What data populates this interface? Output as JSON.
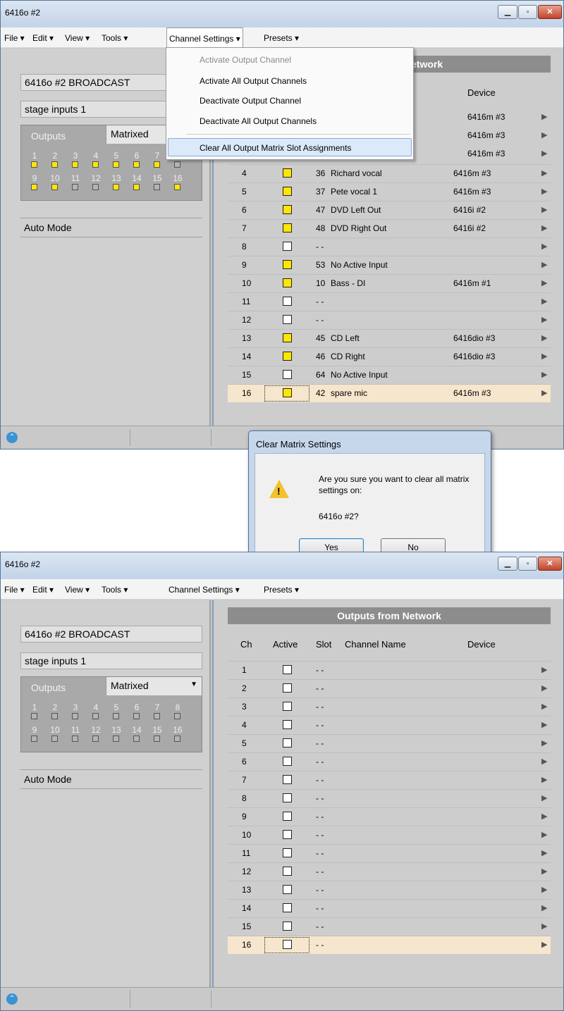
{
  "window_title": "6416o #2",
  "menu": [
    "File",
    "Edit",
    "View",
    "Tools",
    "Channel Settings",
    "Presets"
  ],
  "left": {
    "device_field": "6416o #2 BROADCAST",
    "preset_field": "stage inputs 1",
    "outputs_label": "Outputs",
    "mode_value": "Matrixed",
    "numbers": [
      "1",
      "2",
      "3",
      "4",
      "5",
      "6",
      "7",
      "8",
      "9",
      "10",
      "11",
      "12",
      "13",
      "14",
      "15",
      "16"
    ],
    "auto_mode": "Auto Mode"
  },
  "table": {
    "header": "Outputs from Network",
    "header_partial": "etwork",
    "cols": {
      "ch": "Ch",
      "active": "Active",
      "slot": "Slot",
      "name": "Channel Name",
      "device": "Device"
    }
  },
  "before": {
    "active_squares": [
      true,
      true,
      true,
      true,
      true,
      true,
      true,
      false,
      true,
      true,
      false,
      false,
      true,
      true,
      false,
      true
    ],
    "rows": [
      {
        "ch": "4",
        "active": true,
        "slot": "36",
        "name": "Richard vocal",
        "device": "6416m #3"
      },
      {
        "ch": "5",
        "active": true,
        "slot": "37",
        "name": "Pete vocal 1",
        "device": "6416m #3"
      },
      {
        "ch": "6",
        "active": true,
        "slot": "47",
        "name": "DVD Left Out",
        "device": "6416i #2"
      },
      {
        "ch": "7",
        "active": true,
        "slot": "48",
        "name": "DVD Right Out",
        "device": "6416i #2"
      },
      {
        "ch": "8",
        "active": false,
        "slot": "- -",
        "name": "",
        "device": ""
      },
      {
        "ch": "9",
        "active": true,
        "slot": "53",
        "name": "No Active Input",
        "device": ""
      },
      {
        "ch": "10",
        "active": true,
        "slot": "10",
        "name": "Bass - DI",
        "device": "6416m #1"
      },
      {
        "ch": "11",
        "active": false,
        "slot": "- -",
        "name": "",
        "device": ""
      },
      {
        "ch": "12",
        "active": false,
        "slot": "- -",
        "name": "",
        "device": ""
      },
      {
        "ch": "13",
        "active": true,
        "slot": "45",
        "name": "CD Left",
        "device": "6416dio #3"
      },
      {
        "ch": "14",
        "active": true,
        "slot": "46",
        "name": "CD Right",
        "device": "6416dio #3"
      },
      {
        "ch": "15",
        "active": false,
        "slot": "64",
        "name": "No Active Input",
        "device": ""
      },
      {
        "ch": "16",
        "active": true,
        "slot": "42",
        "name": "spare mic",
        "device": "6416m #3"
      }
    ],
    "hidden_device_rows": [
      "6416m #3",
      "6416m #3",
      "6416m #3"
    ]
  },
  "dropdown": {
    "items": [
      {
        "label": "Activate Output Channel",
        "disabled": true
      },
      {
        "label": "Activate All Output Channels",
        "disabled": false
      },
      {
        "label": "Deactivate Output Channel",
        "disabled": false
      },
      {
        "label": "Deactivate All Output Channels",
        "disabled": false
      },
      {
        "label": "Clear All Output Matrix Slot Assignments",
        "disabled": false
      }
    ]
  },
  "dialog": {
    "title": "Clear Matrix Settings",
    "message": "Are you sure you want to clear all matrix settings on:",
    "device": "6416o #2?",
    "yes": "Yes",
    "no": "No"
  },
  "after": {
    "slot_placeholder": "- -",
    "channels": [
      "1",
      "2",
      "3",
      "4",
      "5",
      "6",
      "7",
      "8",
      "9",
      "10",
      "11",
      "12",
      "13",
      "14",
      "15",
      "16"
    ]
  }
}
